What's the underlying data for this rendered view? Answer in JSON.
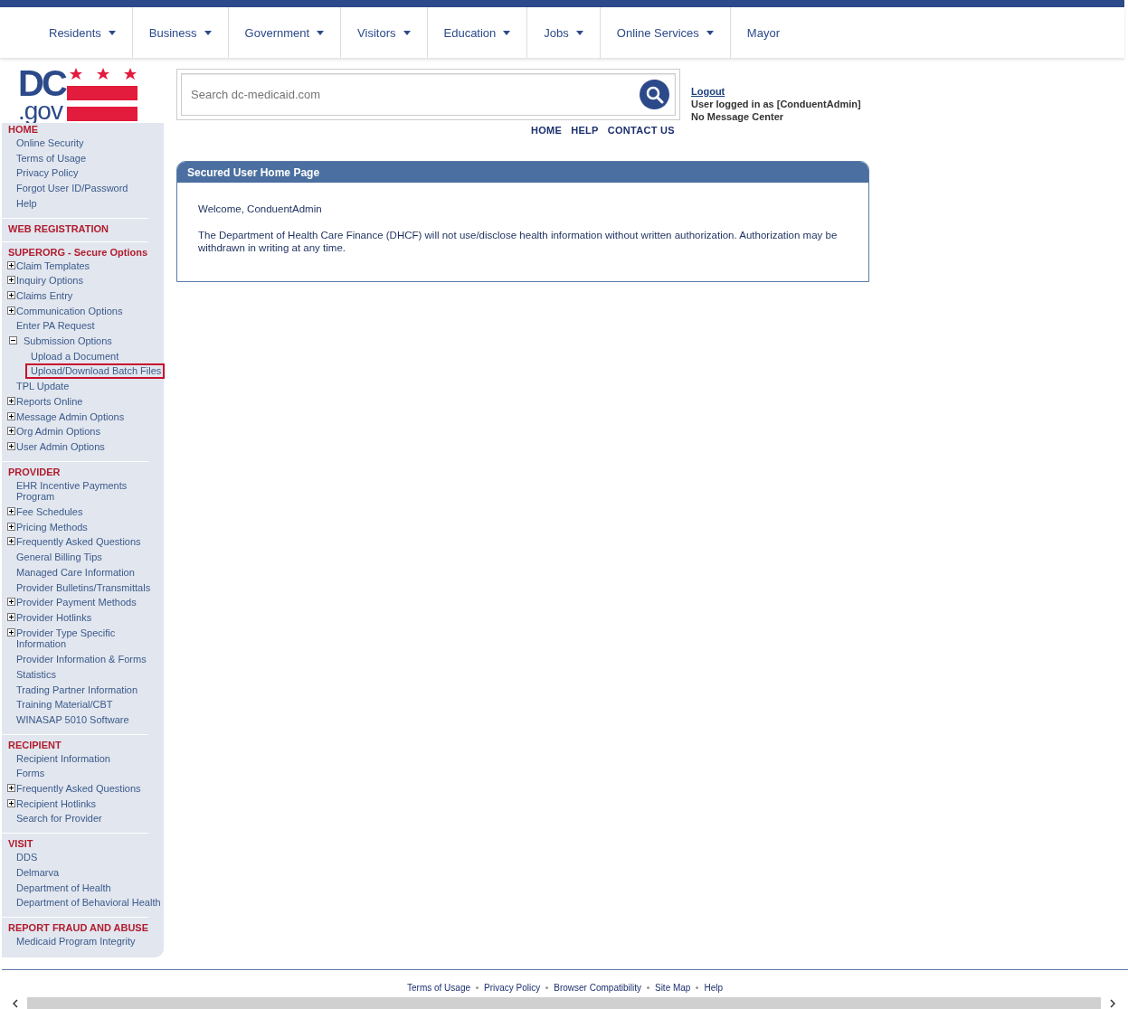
{
  "nav": [
    {
      "label": "Residents",
      "has_menu": true
    },
    {
      "label": "Business",
      "has_menu": true
    },
    {
      "label": "Government",
      "has_menu": true
    },
    {
      "label": "Visitors",
      "has_menu": true
    },
    {
      "label": "Education",
      "has_menu": true
    },
    {
      "label": "Jobs",
      "has_menu": true
    },
    {
      "label": "Online Services",
      "has_menu": true
    },
    {
      "label": "Mayor",
      "has_menu": false
    }
  ],
  "logo": {
    "top": "DC",
    "bottom": ".gov"
  },
  "search": {
    "placeholder": "Search dc-medicaid.com"
  },
  "top_links": [
    "HOME",
    "HELP",
    "CONTACT US"
  ],
  "user": {
    "logout": "Logout",
    "logged_in": "User logged in as [ConduentAdmin]",
    "messages": "No Message Center"
  },
  "sidebar": [
    {
      "heading": "HOME",
      "items": [
        {
          "label": "Online Security",
          "kind": "link",
          "selected": false
        },
        {
          "label": "Terms of Usage",
          "kind": "link",
          "selected": false
        },
        {
          "label": "Privacy Policy",
          "kind": "link",
          "selected": false
        },
        {
          "label": "Forgot User ID/Password",
          "kind": "link",
          "selected": false
        },
        {
          "label": "Help",
          "kind": "link",
          "selected": false
        }
      ]
    },
    {
      "heading": "WEB REGISTRATION"
    },
    {
      "heading": "SUPERORG - Secure Options",
      "items": [
        {
          "label": "Claim Templates",
          "kind": "expandable",
          "expanded": false,
          "selected": false
        },
        {
          "label": "Inquiry Options",
          "kind": "expandable",
          "expanded": false,
          "selected": false
        },
        {
          "label": "Claims Entry",
          "kind": "expandable",
          "expanded": false,
          "selected": false
        },
        {
          "label": "Communication Options",
          "kind": "expandable",
          "expanded": false,
          "selected": false
        },
        {
          "label": "Enter PA Request",
          "kind": "link",
          "selected": false
        },
        {
          "label": "Submission Options",
          "kind": "expandable",
          "expanded": true,
          "selected": false,
          "children": [
            {
              "label": "Upload a Document",
              "selected": false
            },
            {
              "label": "Upload/Download Batch Files",
              "selected": true
            }
          ]
        },
        {
          "label": "TPL Update",
          "kind": "link",
          "selected": false
        },
        {
          "label": "Reports Online",
          "kind": "expandable",
          "expanded": false,
          "selected": false
        },
        {
          "label": "Message Admin Options",
          "kind": "expandable",
          "expanded": false,
          "selected": false
        },
        {
          "label": "Org Admin Options",
          "kind": "expandable",
          "expanded": false,
          "selected": false
        },
        {
          "label": "User Admin Options",
          "kind": "expandable",
          "expanded": false,
          "selected": false
        }
      ]
    },
    {
      "heading": "PROVIDER",
      "items": [
        {
          "label": "EHR Incentive Payments Program",
          "kind": "link",
          "selected": false
        },
        {
          "label": "Fee Schedules",
          "kind": "expandable",
          "expanded": false,
          "selected": false
        },
        {
          "label": "Pricing Methods",
          "kind": "expandable",
          "expanded": false,
          "selected": false
        },
        {
          "label": "Frequently Asked Questions",
          "kind": "expandable",
          "expanded": false,
          "selected": false
        },
        {
          "label": "General Billing Tips",
          "kind": "link",
          "selected": false
        },
        {
          "label": "Managed Care Information",
          "kind": "link",
          "selected": false
        },
        {
          "label": "Provider Bulletins/Transmittals",
          "kind": "link",
          "selected": false
        },
        {
          "label": "Provider Payment Methods",
          "kind": "expandable",
          "expanded": false,
          "selected": false
        },
        {
          "label": "Provider Hotlinks",
          "kind": "expandable",
          "expanded": false,
          "selected": false
        },
        {
          "label": "Provider Type Specific Information",
          "kind": "expandable",
          "expanded": false,
          "selected": false
        },
        {
          "label": "Provider Information & Forms",
          "kind": "link",
          "selected": false
        },
        {
          "label": "Statistics",
          "kind": "link",
          "selected": false
        },
        {
          "label": "Trading Partner Information",
          "kind": "link",
          "selected": false
        },
        {
          "label": "Training Material/CBT",
          "kind": "link",
          "selected": false
        },
        {
          "label": "WINASAP 5010 Software",
          "kind": "link",
          "selected": false
        }
      ]
    },
    {
      "heading": "RECIPIENT",
      "items": [
        {
          "label": "Recipient Information",
          "kind": "link",
          "selected": false
        },
        {
          "label": "Forms",
          "kind": "link",
          "selected": false
        },
        {
          "label": "Frequently Asked Questions",
          "kind": "expandable",
          "expanded": false,
          "selected": false
        },
        {
          "label": "Recipient Hotlinks",
          "kind": "expandable",
          "expanded": false,
          "selected": false
        },
        {
          "label": "Search for Provider",
          "kind": "link",
          "selected": false
        }
      ]
    },
    {
      "heading": "VISIT",
      "items": [
        {
          "label": "DDS",
          "kind": "link",
          "selected": false
        },
        {
          "label": "Delmarva",
          "kind": "link",
          "selected": false
        },
        {
          "label": "Department of Health",
          "kind": "link",
          "selected": false
        },
        {
          "label": "Department of Behavioral Health",
          "kind": "link",
          "selected": false
        }
      ]
    },
    {
      "heading": "REPORT FRAUD AND ABUSE",
      "items": [
        {
          "label": "Medicaid Program Integrity",
          "kind": "link",
          "selected": false
        }
      ]
    }
  ],
  "panel": {
    "title": "Secured User Home Page",
    "welcome": "Welcome, ConduentAdmin",
    "notice": "The Department of Health Care Finance (DHCF) will not use/disclose health information without written authorization. Authorization may be withdrawn in writing at any time."
  },
  "footer_links": [
    "Terms of Usage",
    "Privacy Policy",
    "Browser Compatibility",
    "Site Map",
    "Help"
  ]
}
